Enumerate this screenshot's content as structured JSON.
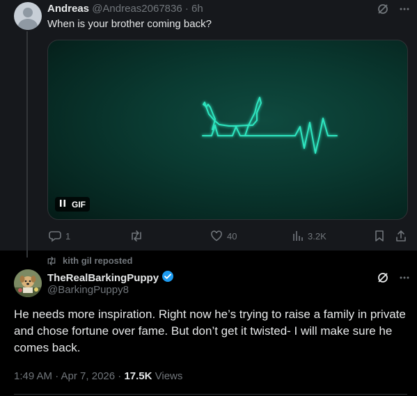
{
  "tweet1": {
    "author_name": "Andreas",
    "author_handle": "@Andreas2067836",
    "separator": "·",
    "time": "6h",
    "text": "When is your brother coming back?",
    "media_badge": "GIF",
    "actions": {
      "replies": "1",
      "reposts": "",
      "likes": "40",
      "views": "3.2K"
    }
  },
  "repost": {
    "label": "kith gil reposted"
  },
  "tweet2": {
    "author_name": "TheRealBarkingPuppy",
    "author_handle": "@BarkingPuppy8",
    "text": "He needs more inspiration. Right now he’s trying to raise a family in private and chose fortune over fame. But don’t get it twisted- I will make sure he comes back.",
    "timestamp": "1:49 AM · Apr 7, 2026 · ",
    "views_count": "17.5K",
    "views_label": " Views"
  },
  "colors": {
    "background": "#000000",
    "highlight_bg": "#16181c",
    "text_primary": "#e7e9ea",
    "text_secondary": "#71767b",
    "verified": "#1d9bf0",
    "gif_glow": "#2ee6c0"
  },
  "icons": [
    "grok-icon",
    "more-icon",
    "pause-icon",
    "reply-icon",
    "repost-icon",
    "like-icon",
    "views-icon",
    "bookmark-icon",
    "share-icon",
    "verified-badge-icon"
  ]
}
